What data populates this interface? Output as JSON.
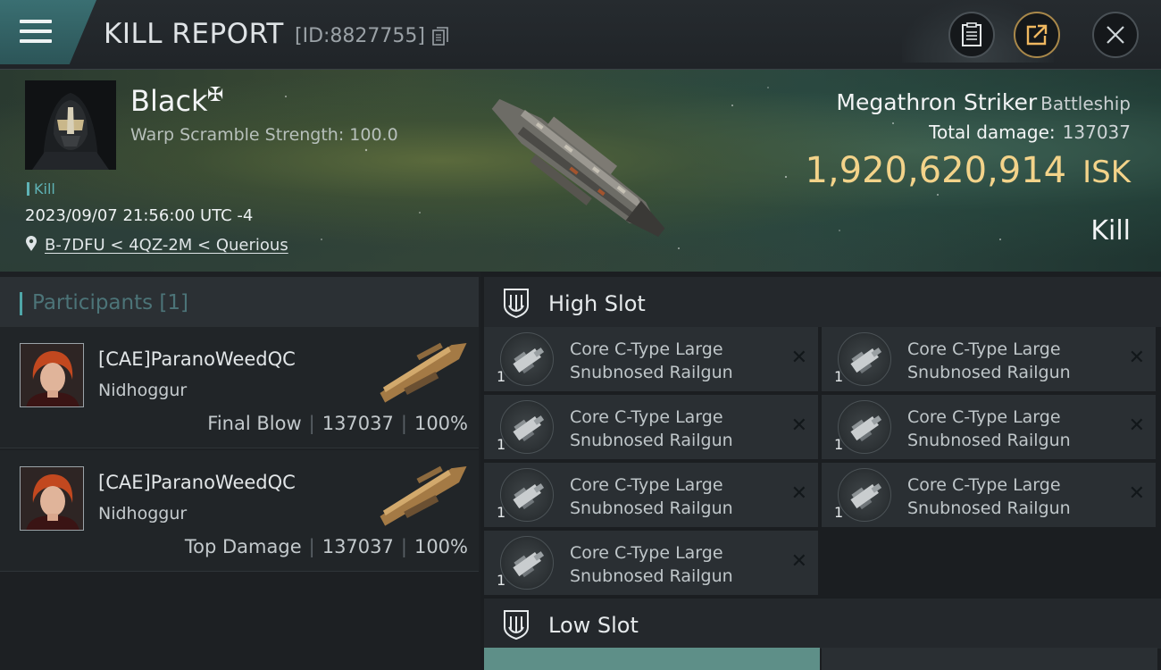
{
  "header": {
    "title": "KILL REPORT",
    "report_id": "[ID:8827755]"
  },
  "victim": {
    "name": "Black",
    "corp_icon": "cross-pattee-icon",
    "scramble": "Warp Scramble Strength: 100.0",
    "tag": "Kill",
    "datetime": "2023/09/07 21:56:00 UTC -4",
    "location": "B-7DFU < 4QZ-2M < Querious"
  },
  "ship": {
    "name": "Megathron Striker",
    "class": "Battleship",
    "total_damage_label": "Total damage:",
    "total_damage": "137037",
    "isk_value": "1,920,620,914",
    "isk_unit": "ISK",
    "status": "Kill"
  },
  "participants": {
    "title": "Participants",
    "count": "[1]",
    "rows": [
      {
        "name": "[CAE]ParanoWeedQC",
        "ship": "Nidhoggur",
        "role": "Final Blow",
        "damage": "137037",
        "percent": "100%"
      },
      {
        "name": "[CAE]ParanoWeedQC",
        "ship": "Nidhoggur",
        "role": "Top Damage",
        "damage": "137037",
        "percent": "100%"
      }
    ]
  },
  "fitting": {
    "high_slot": {
      "title": "High Slot",
      "modules": [
        {
          "name": "Core C-Type Large Snubnosed Railgun",
          "qty": "1"
        },
        {
          "name": "Core C-Type Large Snubnosed Railgun",
          "qty": "1"
        },
        {
          "name": "Core C-Type Large Snubnosed Railgun",
          "qty": "1"
        },
        {
          "name": "Core C-Type Large Snubnosed Railgun",
          "qty": "1"
        },
        {
          "name": "Core C-Type Large Snubnosed Railgun",
          "qty": "1"
        },
        {
          "name": "Core C-Type Large Snubnosed Railgun",
          "qty": "1"
        },
        {
          "name": "Core C-Type Large Snubnosed Railgun",
          "qty": "1"
        }
      ]
    },
    "low_slot": {
      "title": "Low Slot"
    }
  },
  "icons": {
    "menu": "hamburger-menu-icon",
    "copy": "copy-icon",
    "clipboard": "clipboard-icon",
    "share": "share-icon",
    "close": "close-icon",
    "location": "location-pin-icon",
    "slot": "slot-emblem-icon",
    "destroyed": "x-icon"
  },
  "colors": {
    "accent_teal": "#4fa6a8",
    "isk_gold": "#f3d38a",
    "share_ring": "#a9884a"
  }
}
